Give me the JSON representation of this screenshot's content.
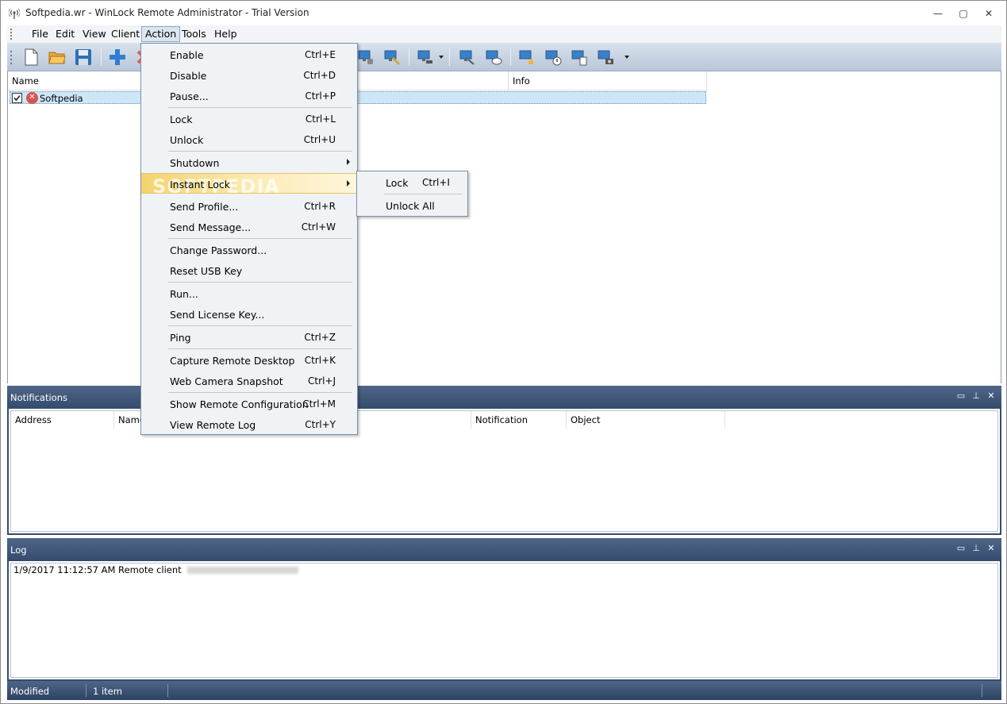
{
  "window": {
    "title": "Softpedia.wr - WinLock Remote Administrator - Trial Version",
    "controls": {
      "minimize": "—",
      "maximize": "▢",
      "close": "✕"
    }
  },
  "menubar": [
    "File",
    "Edit",
    "View",
    "Client",
    "Action",
    "Tools",
    "Help"
  ],
  "list": {
    "columns": [
      "Name",
      "Info"
    ],
    "rows": [
      {
        "checked": true,
        "status": "error",
        "name": "Softpedia"
      }
    ]
  },
  "action_menu": [
    {
      "label": "Enable",
      "shortcut": "Ctrl+E"
    },
    {
      "label": "Disable",
      "shortcut": "Ctrl+D"
    },
    {
      "label": "Pause...",
      "shortcut": "Ctrl+P"
    },
    {
      "label": "Lock",
      "shortcut": "Ctrl+L"
    },
    {
      "label": "Unlock",
      "shortcut": "Ctrl+U"
    },
    {
      "label": "Shutdown",
      "shortcut": ""
    },
    {
      "label": "Instant Lock",
      "shortcut": ""
    },
    {
      "label": "Send Profile...",
      "shortcut": "Ctrl+R"
    },
    {
      "label": "Send Message...",
      "shortcut": "Ctrl+W"
    },
    {
      "label": "Change Password...",
      "shortcut": ""
    },
    {
      "label": "Reset USB Key",
      "shortcut": ""
    },
    {
      "label": "Run...",
      "shortcut": ""
    },
    {
      "label": "Send License Key...",
      "shortcut": ""
    },
    {
      "label": "Ping",
      "shortcut": "Ctrl+Z"
    },
    {
      "label": "Capture Remote Desktop",
      "shortcut": "Ctrl+K"
    },
    {
      "label": "Web Camera Snapshot",
      "shortcut": "Ctrl+J"
    },
    {
      "label": "Show Remote Configuration",
      "shortcut": "Ctrl+M"
    },
    {
      "label": "View Remote Log",
      "shortcut": "Ctrl+Y"
    }
  ],
  "watermark": "SOFTPEDIA",
  "instant_lock_submenu": [
    {
      "label": "Lock",
      "shortcut": "Ctrl+I"
    },
    {
      "label": "Unlock All",
      "shortcut": ""
    }
  ],
  "notifications": {
    "title": "Notifications",
    "columns": [
      "Address",
      "Name",
      "Notification",
      "Object"
    ]
  },
  "log": {
    "title": "Log",
    "entries": [
      "1/9/2017 11:12:57 AM Remote client"
    ]
  },
  "statusbar": {
    "state": "Modified",
    "count": "1 item"
  },
  "colors": {
    "pane_header": "#344b6d",
    "highlight": "#f3d36d",
    "selection": "#cde7f7",
    "toolbar_blue": "#2f7fd1"
  }
}
